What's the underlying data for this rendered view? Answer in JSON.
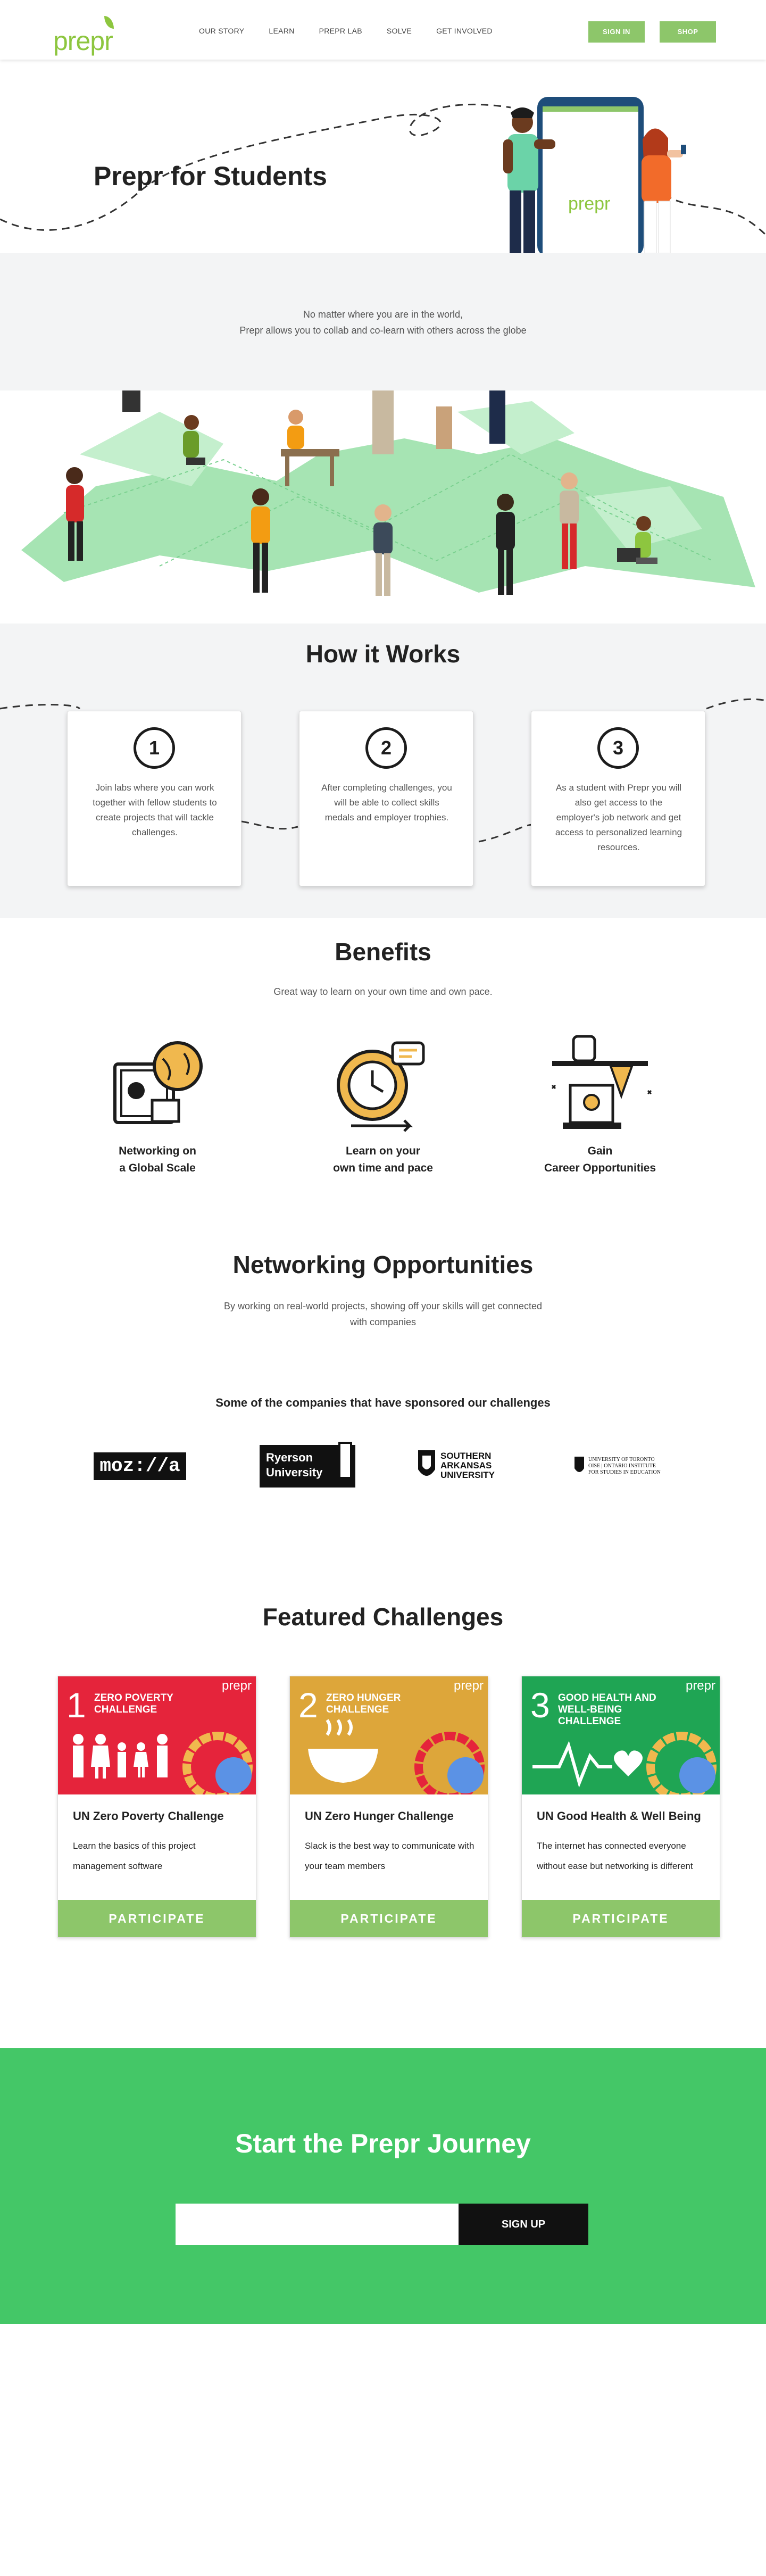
{
  "nav": {
    "logo": "prepr",
    "links": [
      "OUR STORY",
      "LEARN",
      "PREPR LAB",
      "SOLVE",
      "GET INVOLVED"
    ],
    "sign_in": "SIGN IN",
    "shop": "SHOP"
  },
  "hero": {
    "title": "Prepr for Students",
    "phone_brand": "prepr"
  },
  "about": {
    "line1": "No matter where you are in the world,",
    "line2": "Prepr allows you to collab and co-learn with others across the globe"
  },
  "how": {
    "title": "How it Works",
    "steps": [
      {
        "num": "1",
        "text": "Join labs where you can work together with fellow students to create projects that will tackle challenges."
      },
      {
        "num": "2",
        "text": "After completing challenges, you will be able to collect skills medals and employer trophies."
      },
      {
        "num": "3",
        "text": "As a student with Prepr you will also get access to the employer's job network and get access to personalized learning resources."
      }
    ]
  },
  "benefits": {
    "title": "Benefits",
    "subtitle": "Great way to learn on your own time and own pace.",
    "items": [
      {
        "line1": "Networking on",
        "line2": "a Global Scale",
        "icon": "globe-book-icon"
      },
      {
        "line1": "Learn on your",
        "line2": "own time and pace",
        "icon": "clock-chat-icon"
      },
      {
        "line1": "Gain",
        "line2": "Career Opportunities",
        "icon": "trophy-hand-icon"
      }
    ]
  },
  "networking": {
    "title": "Networking Opportunities",
    "line1": "By working on real-world projects, showing off your skills will get connected",
    "line2": "with companies",
    "sponsors_heading": "Some of the companies that have sponsored our challenges",
    "sponsors": {
      "mozilla": "moz://a",
      "ryerson_1": "Ryerson",
      "ryerson_2": "University",
      "saa_1": "SOUTHERN",
      "saa_2": "ARKANSAS",
      "saa_3": "UNIVERSITY",
      "uoft_1": "UNIVERSITY OF TORONTO",
      "uoft_2": "OISE | ONTARIO INSTITUTE",
      "uoft_3": "FOR STUDIES IN EDUCATION"
    }
  },
  "challenges": {
    "title": "Featured Challenges",
    "button": "PARTICIPATE",
    "items": [
      {
        "num": "1",
        "name": "ZERO POVERTY CHALLENGE",
        "title": "UN Zero Poverty Challenge",
        "desc": "Learn the basics of this project management software",
        "color": "#e5243b"
      },
      {
        "num": "2",
        "name": "ZERO HUNGER CHALLENGE",
        "title": "UN Zero Hunger Challenge",
        "desc": "Slack is the best way to communicate with your team members",
        "color": "#dda63a"
      },
      {
        "num": "3",
        "name": "GOOD HEALTH AND WELL-BEING CHALLENGE",
        "title": "UN Good Health & Well Being",
        "desc": "The internet has connected everyone without ease but networking is different",
        "color": "#4c9f38"
      }
    ]
  },
  "cta": {
    "title": "Start the Prepr Journey",
    "input_placeholder": "",
    "button": "SIGN UP"
  },
  "colors": {
    "brand_green": "#8dc63f",
    "button_green": "#8dc66a",
    "cta_green": "#44c767",
    "section_gray": "#f3f4f5"
  }
}
